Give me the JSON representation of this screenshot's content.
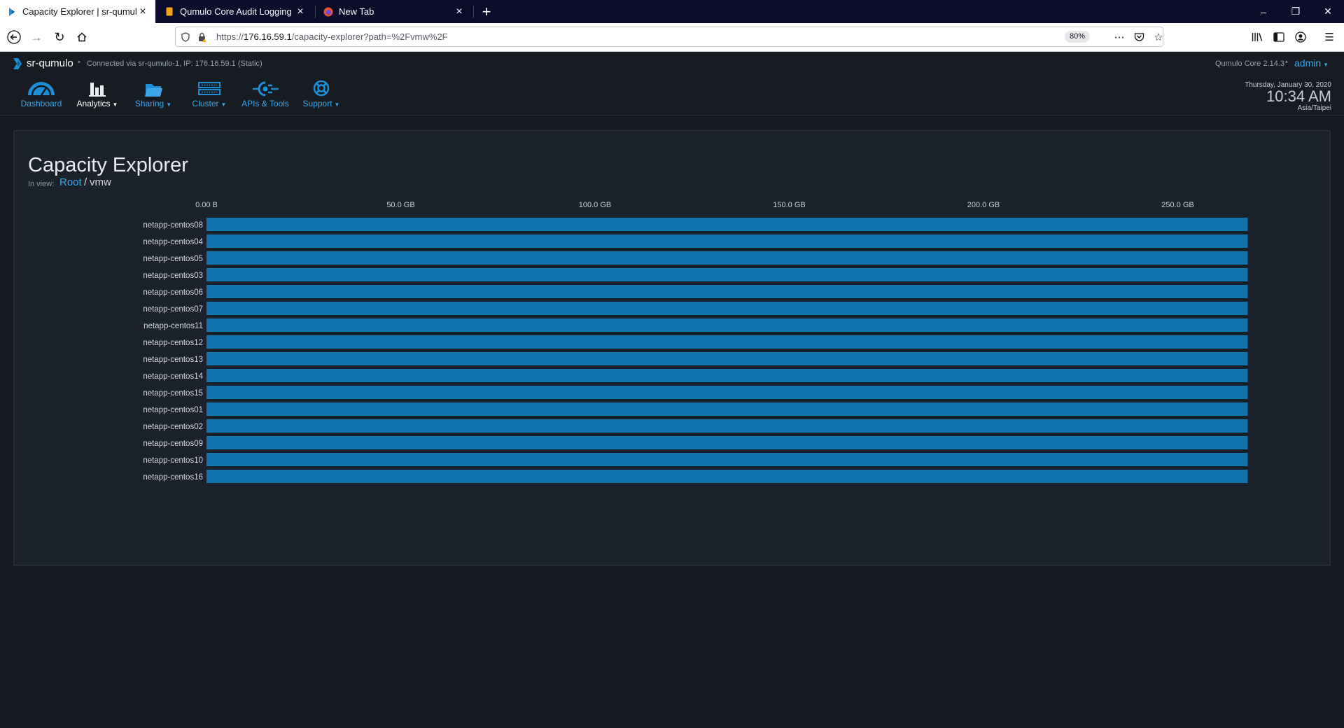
{
  "browser": {
    "tabs": [
      {
        "title": "Capacity Explorer | sr-qumulo",
        "active": true,
        "icon": "qumulo-favicon"
      },
      {
        "title": "Qumulo Core Audit Logging -",
        "active": false,
        "icon": "doc-favicon"
      },
      {
        "title": "New Tab",
        "active": false,
        "icon": "firefox-favicon"
      }
    ],
    "url_prefix": "https://",
    "url_host": "176.16.59.1",
    "url_path": "/capacity-explorer?path=%2Fvmw%2F",
    "zoom": "80%"
  },
  "header": {
    "cluster_name": "sr-qumulo",
    "separator": "•",
    "connection": "Connected via sr-qumulo-1, IP: 176.16.59.1 (Static)",
    "version": "Qumulo Core 2.14.3",
    "user": "admin"
  },
  "nav": {
    "items": [
      {
        "label": "Dashboard",
        "icon": "dashboard-gauge-icon",
        "dropdown": false
      },
      {
        "label": "Analytics",
        "icon": "analytics-bars-icon",
        "dropdown": true
      },
      {
        "label": "Sharing",
        "icon": "sharing-folder-icon",
        "dropdown": true
      },
      {
        "label": "Cluster",
        "icon": "cluster-server-icon",
        "dropdown": true
      },
      {
        "label": "APIs & Tools",
        "icon": "api-plug-icon",
        "dropdown": false
      },
      {
        "label": "Support",
        "icon": "support-lifebuoy-icon",
        "dropdown": true
      }
    ],
    "active_item": "Analytics",
    "clock": {
      "date": "Thursday, January 30, 2020",
      "time": "10:34 AM",
      "timezone": "Asia/Taipei"
    }
  },
  "page": {
    "title": "Capacity Explorer",
    "in_view_label": "In view:",
    "breadcrumb_root": "Root",
    "breadcrumb_sep": "/",
    "breadcrumb_current": "vmw"
  },
  "colors": {
    "accent": "#3ba7e6",
    "bar": "#1176b0",
    "background": "#151920",
    "panel": "#1c222b"
  },
  "chart_data": {
    "type": "bar",
    "orientation": "horizontal",
    "categories": [
      "netapp-centos08",
      "netapp-centos04",
      "netapp-centos05",
      "netapp-centos03",
      "netapp-centos06",
      "netapp-centos07",
      "netapp-centos11",
      "netapp-centos12",
      "netapp-centos13",
      "netapp-centos14",
      "netapp-centos15",
      "netapp-centos01",
      "netapp-centos02",
      "netapp-centos09",
      "netapp-centos10",
      "netapp-centos16"
    ],
    "values": [
      268,
      268,
      268,
      268,
      268,
      268,
      268,
      268,
      268,
      268,
      268,
      268,
      268,
      268,
      268,
      268
    ],
    "unit": "GB",
    "x_ticks": [
      {
        "value": 0,
        "label": "0.00 B"
      },
      {
        "value": 50,
        "label": "50.0 GB"
      },
      {
        "value": 100,
        "label": "100.0 GB"
      },
      {
        "value": 150,
        "label": "150.0 GB"
      },
      {
        "value": 200,
        "label": "200.0 GB"
      },
      {
        "value": 250,
        "label": "250.0 GB"
      }
    ],
    "xlim": [
      0,
      268
    ],
    "grid": false,
    "legend": "none"
  }
}
